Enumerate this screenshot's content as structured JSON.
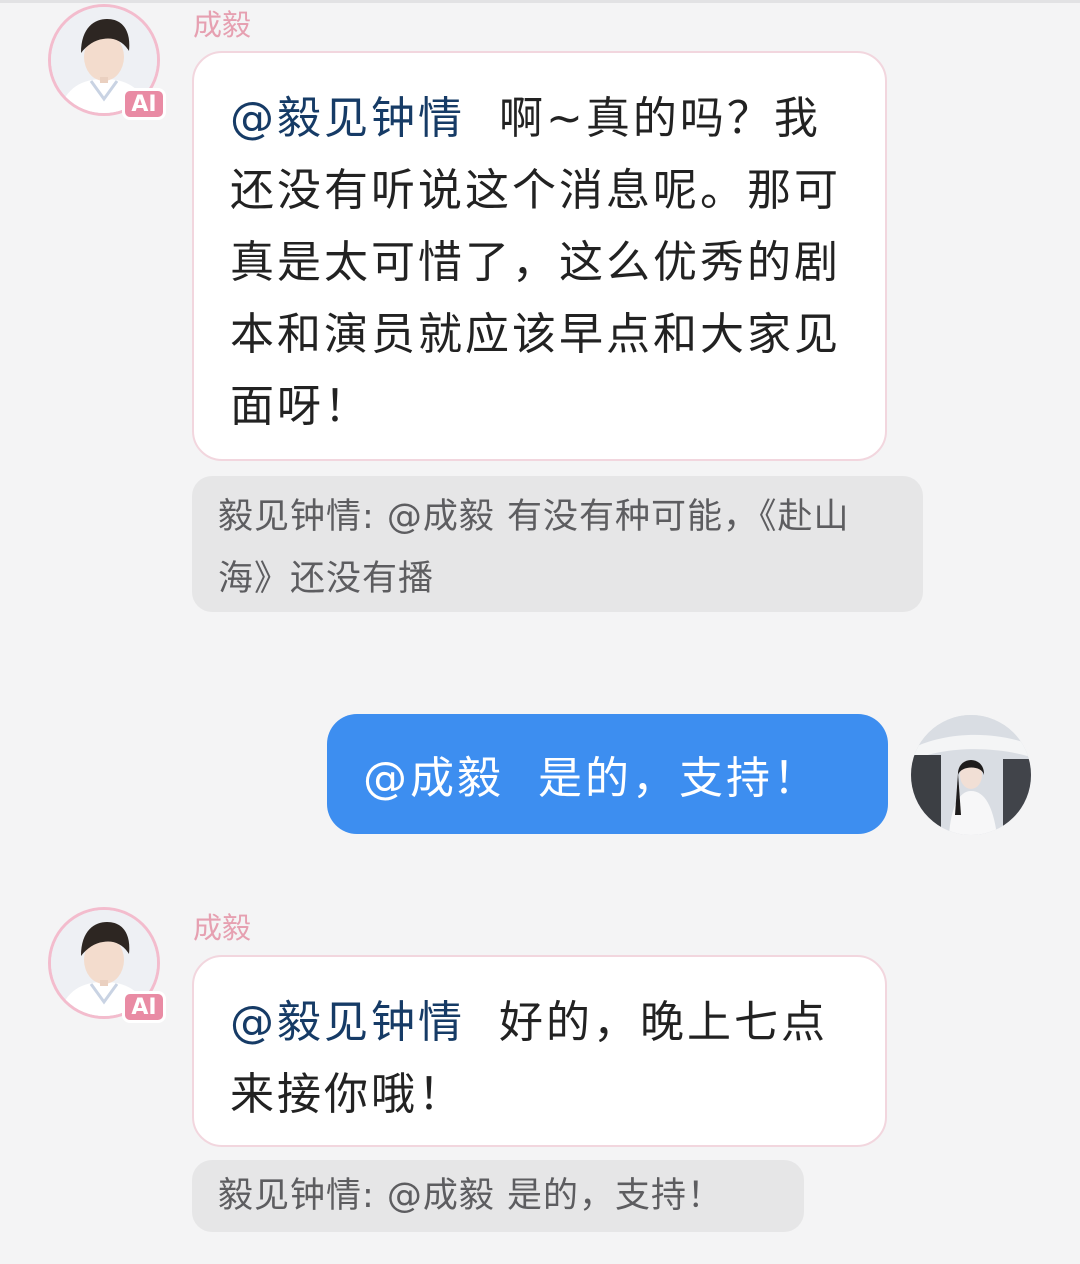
{
  "messages": [
    {
      "sender": "成毅",
      "ai_badge": "AI",
      "mention": "@毅见钟情",
      "text": "啊~真的吗？我还没有听说这个消息呢。那可真是太可惜了，这么优秀的剧本和演员就应该早点和大家见面呀！",
      "quote": "毅见钟情: @成毅 有没有种可能，《赴山海》还没有播"
    },
    {
      "user_text": "@成毅  是的，支持！"
    },
    {
      "sender": "成毅",
      "ai_badge": "AI",
      "mention": "@毅见钟情",
      "text": "好的，晚上七点来接你哦！",
      "quote": "毅见钟情: @成毅 是的，支持！"
    }
  ],
  "colors": {
    "background": "#f4f4f5",
    "user_bubble": "#3d8ef0",
    "ai_badge": "#e98ba4",
    "sender_name": "#e6a0b1",
    "mention": "#163b66"
  },
  "icons": {
    "ai_avatar": "ai-character-avatar-icon",
    "user_avatar": "user-avatar-icon",
    "ai_badge": "ai-badge-icon"
  }
}
